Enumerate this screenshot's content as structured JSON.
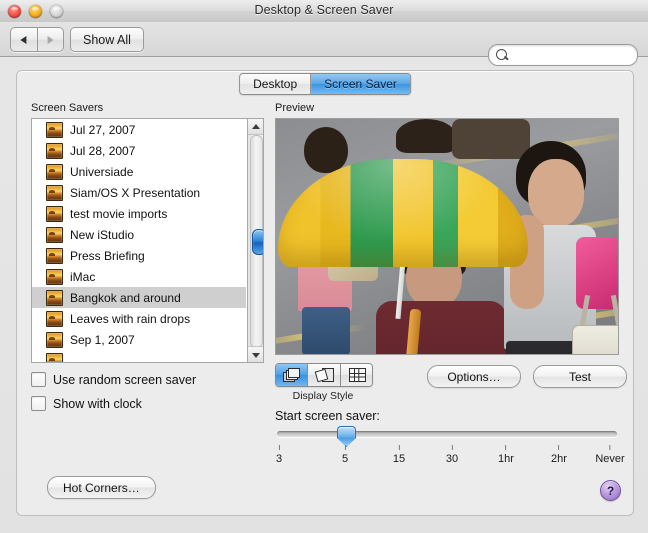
{
  "window": {
    "title": "Desktop & Screen Saver",
    "traffic_lights": [
      "close",
      "minimize",
      "zoom"
    ]
  },
  "toolbar": {
    "back_label": "back-arrow",
    "forward_label": "forward-arrow",
    "show_all_label": "Show All",
    "search": {
      "value": "",
      "placeholder": "",
      "icon": "search-icon"
    }
  },
  "tabs": [
    {
      "label": "Desktop",
      "selected": false
    },
    {
      "label": "Screen Saver",
      "selected": true
    }
  ],
  "left": {
    "list_label": "Screen Savers",
    "items": [
      {
        "label": "Jul 27, 2007",
        "selected": false
      },
      {
        "label": "Jul 28, 2007",
        "selected": false
      },
      {
        "label": "Universiade",
        "selected": false
      },
      {
        "label": "Siam/OS X Presentation",
        "selected": false
      },
      {
        "label": "test movie imports",
        "selected": false
      },
      {
        "label": "New iStudio",
        "selected": false
      },
      {
        "label": "Press Briefing",
        "selected": false
      },
      {
        "label": "iMac",
        "selected": false
      },
      {
        "label": "Bangkok and around",
        "selected": true
      },
      {
        "label": "Leaves with rain drops",
        "selected": false
      },
      {
        "label": "Sep 1, 2007",
        "selected": false
      }
    ],
    "checkboxes": [
      {
        "label": "Use random screen saver",
        "checked": false
      },
      {
        "label": "Show with clock",
        "checked": false
      }
    ],
    "hot_corners_label": "Hot Corners…"
  },
  "right": {
    "preview_label": "Preview",
    "preview_description": "Street photo of people with a yellow and green umbrella",
    "display_style": {
      "caption": "Display Style",
      "options": [
        {
          "name": "slideshow",
          "selected": true
        },
        {
          "name": "collage",
          "selected": false
        },
        {
          "name": "mosaic",
          "selected": false
        }
      ]
    },
    "options_button": "Options…",
    "test_button": "Test",
    "slider": {
      "label": "Start screen saver:",
      "value": "5",
      "ticks": [
        "3",
        "5",
        "15",
        "30",
        "1hr",
        "2hr",
        "Never"
      ]
    }
  },
  "help": {
    "label": "?"
  },
  "colors": {
    "accent_blue": "#3a90df",
    "selection_gray": "#cfcfcf",
    "panel_bg": "#ececec",
    "help_purple": "#8f6bc0"
  }
}
